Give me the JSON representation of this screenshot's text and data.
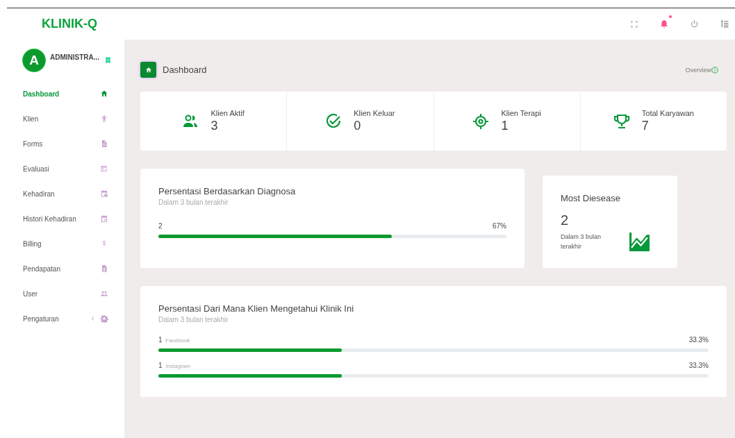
{
  "brand": "KLINIK-Q",
  "topbar": {
    "notification_unread": true
  },
  "user": {
    "initial": "A",
    "name": "ADMINISTRA..."
  },
  "sidebar": {
    "items": [
      {
        "label": "Dashboard",
        "selected": true
      },
      {
        "label": "Klien",
        "selected": false
      },
      {
        "label": "Forms",
        "selected": false
      },
      {
        "label": "Evaluasi",
        "selected": false
      },
      {
        "label": "Kehadiran",
        "selected": false
      },
      {
        "label": "Histori Kehadiran",
        "selected": false
      },
      {
        "label": "Billing",
        "selected": false
      },
      {
        "label": "Pendapatan",
        "selected": false
      },
      {
        "label": "User",
        "selected": false
      },
      {
        "label": "Pengaturan",
        "selected": false,
        "expandable": true
      }
    ]
  },
  "page_header": {
    "title": "Dashboard",
    "overview": "Overview"
  },
  "stats": [
    {
      "label": "Klien Aktif",
      "value": "3"
    },
    {
      "label": "Klien Keluar",
      "value": "0"
    },
    {
      "label": "Klien Terapi",
      "value": "1"
    },
    {
      "label": "Total Karyawan",
      "value": "7"
    }
  ],
  "diagnosis": {
    "title": "Persentasi Berdasarkan Diagnosa",
    "subtitle": "Dalam 3 bulan terakhir",
    "rows": [
      {
        "count": "2",
        "percent": "67%",
        "level": 0.67
      }
    ]
  },
  "most_disease": {
    "title": "Most Diesease",
    "value": "2",
    "caption": "Dalam 3 bulan terakhir"
  },
  "sources": {
    "title": "Persentasi Dari Mana Klien Mengetahui Klinik Ini",
    "subtitle": "Dalam 3 bulan terakhir",
    "rows": [
      {
        "count": "1",
        "label": "Facebook",
        "percent": "33.3%",
        "level": 0.333
      },
      {
        "count": "1",
        "label": "Instagram",
        "percent": "33.3%",
        "level": 0.333
      }
    ]
  }
}
